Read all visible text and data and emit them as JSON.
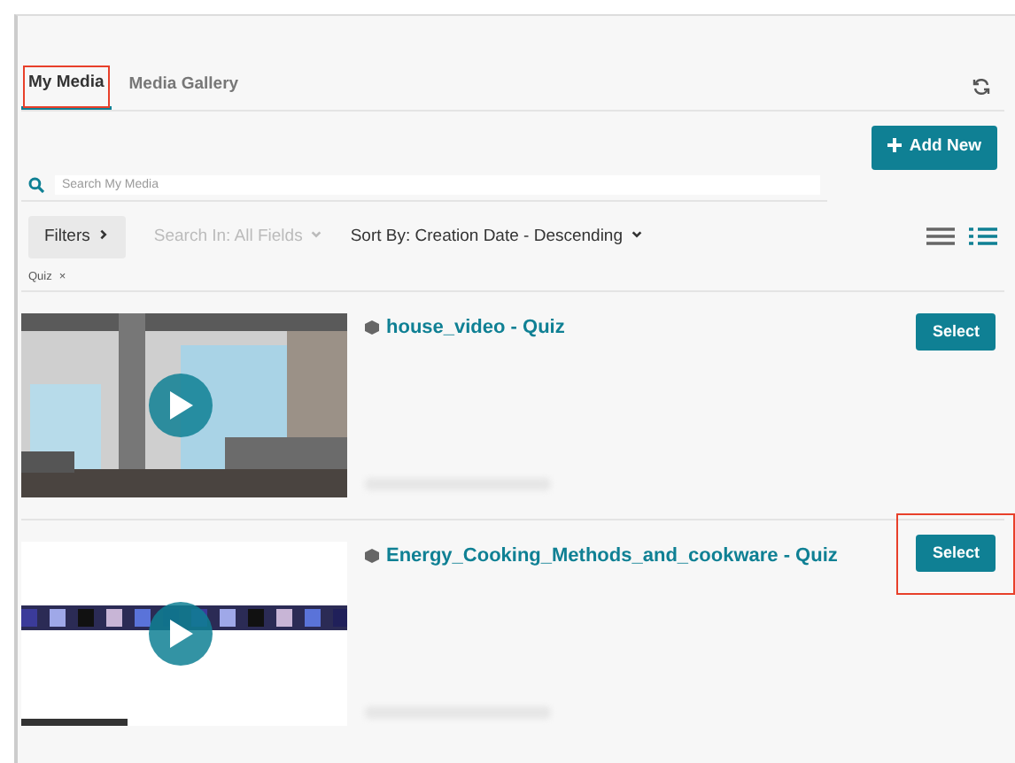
{
  "tabs": [
    {
      "label": "My Media",
      "selected": true,
      "highlighted": true
    },
    {
      "label": "Media Gallery",
      "selected": false,
      "highlighted": false
    }
  ],
  "add_button": "Add New",
  "search": {
    "placeholder": "Search My Media"
  },
  "filters_button": "Filters",
  "search_in": {
    "label": "Search In: All Fields",
    "disabled": true
  },
  "sort_by": "Sort By: Creation Date - Descending",
  "view_modes": [
    {
      "kind": "compact",
      "selected": false
    },
    {
      "kind": "detailed",
      "selected": true
    }
  ],
  "active_filters": [
    {
      "label": "Quiz",
      "remove": "×"
    }
  ],
  "media": [
    {
      "title": "house_video - Quiz",
      "button": "Select",
      "highlighted": false
    },
    {
      "title": "Energy_Cooking_Methods_and_cookware - Quiz",
      "button": "Select",
      "highlighted": true
    }
  ]
}
